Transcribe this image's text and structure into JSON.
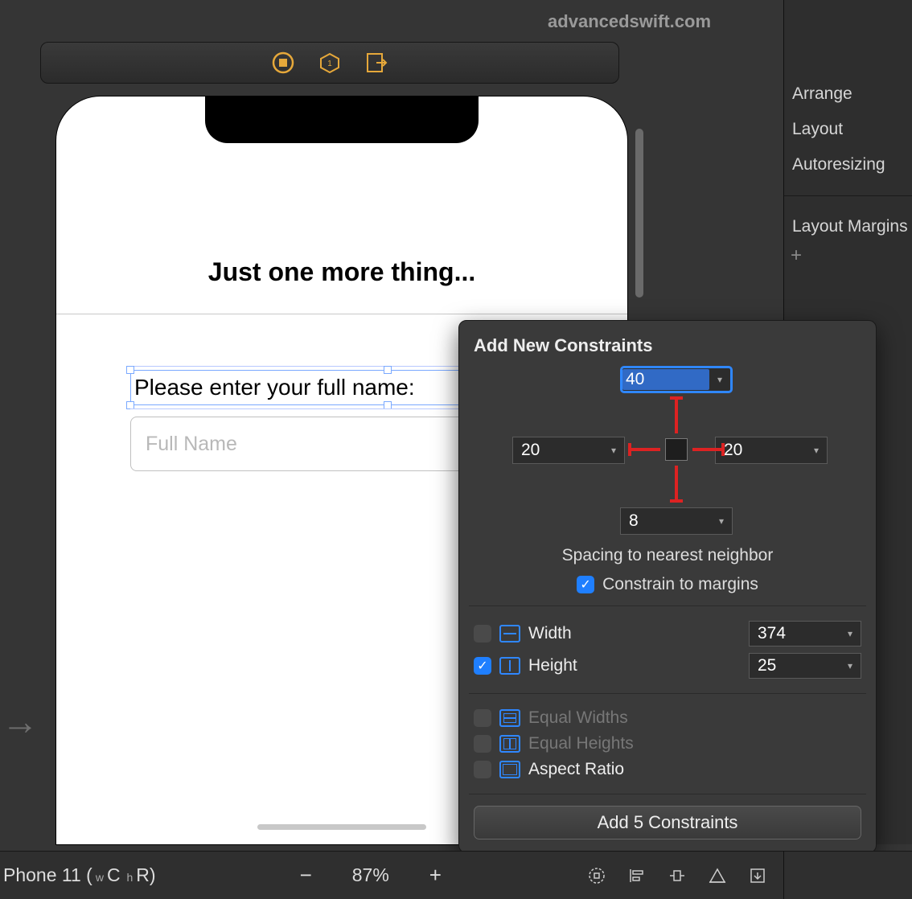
{
  "watermark": "advancedswift.com",
  "phone": {
    "nav_title": "Just one more thing...",
    "form_label": "Please enter your full name:",
    "placeholder": "Full Name"
  },
  "inspector": {
    "row_arrange": "Arrange",
    "row_layout": "Layout",
    "row_autoresize": "Autoresizing",
    "row_margins": "Layout Margins"
  },
  "popover": {
    "title": "Add New Constraints",
    "top": "40",
    "left": "20",
    "right": "20",
    "bottom": "8",
    "spacing_label": "Spacing to nearest neighbor",
    "constrain_margins": "Constrain to margins",
    "width_label": "Width",
    "width_value": "374",
    "height_label": "Height",
    "height_value": "25",
    "equal_widths": "Equal Widths",
    "equal_heights": "Equal Heights",
    "aspect_ratio": "Aspect Ratio",
    "add_button": "Add 5 Constraints"
  },
  "bottom": {
    "device": "Phone 11 (",
    "wc": "C",
    "hr": "R)",
    "zoom": "87%"
  }
}
